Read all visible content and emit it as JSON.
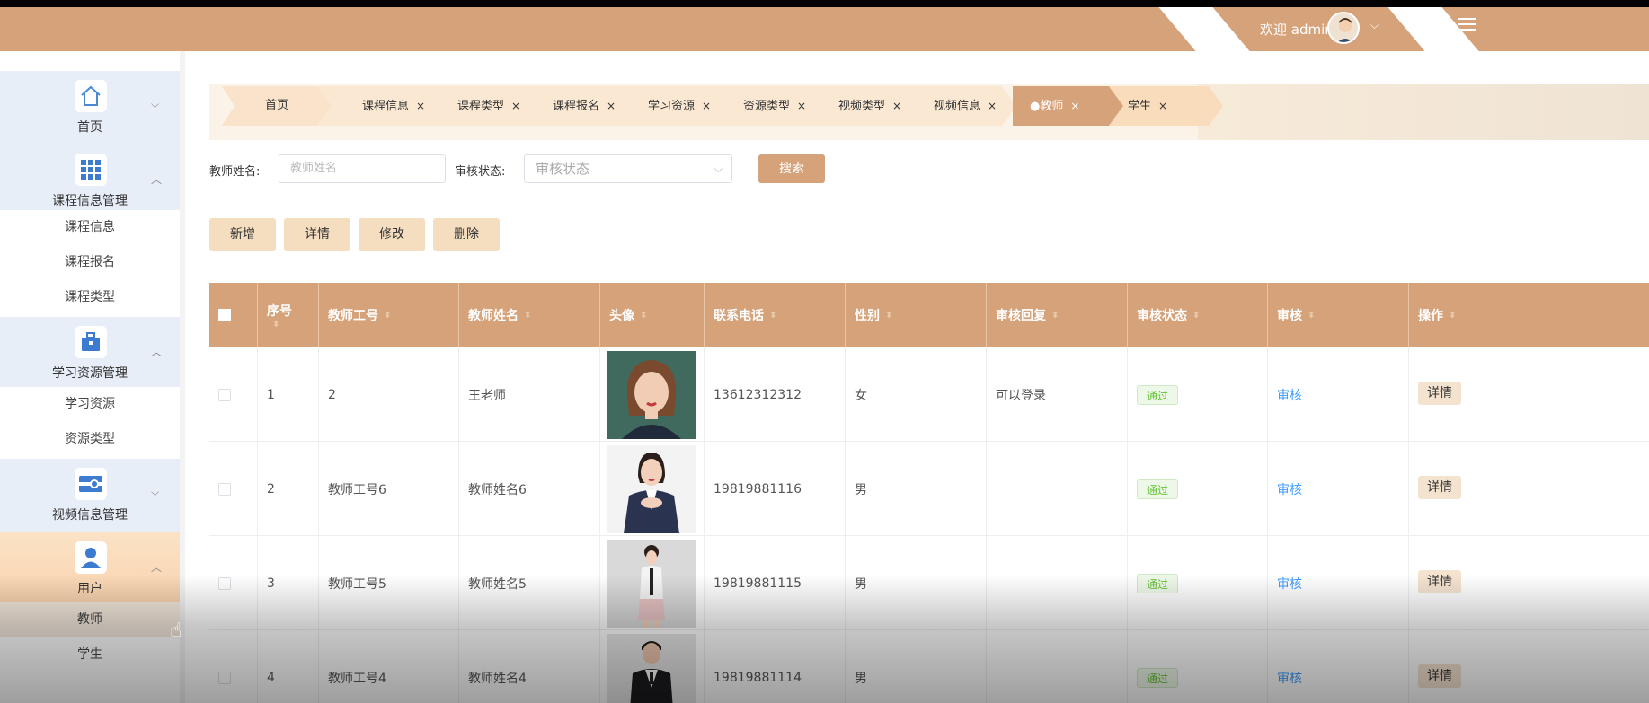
{
  "header": {
    "welcome_text": "欢迎 admin",
    "chevron_icon": "chevron-down-icon",
    "menu_icon": "menu-toggle-icon"
  },
  "sidebar": {
    "groups": [
      {
        "label": "首页",
        "icon": "home-icon",
        "expanded": false,
        "sub": []
      },
      {
        "label": "课程信息管理",
        "icon": "grid-icon",
        "expanded": true,
        "sub": [
          "课程信息",
          "课程报名",
          "课程类型"
        ]
      },
      {
        "label": "学习资源管理",
        "icon": "briefcase-icon",
        "expanded": true,
        "sub": [
          "学习资源",
          "资源类型"
        ]
      },
      {
        "label": "视频信息管理",
        "icon": "video-icon",
        "expanded": false,
        "sub": []
      },
      {
        "label": "用户",
        "icon": "user-icon",
        "expanded": true,
        "sub": [
          "教师",
          "学生"
        ]
      }
    ],
    "active_sub": "教师"
  },
  "tabs": [
    {
      "label": "首页",
      "closable": false
    },
    {
      "label": "课程信息",
      "closable": true
    },
    {
      "label": "课程类型",
      "closable": true
    },
    {
      "label": "课程报名",
      "closable": true
    },
    {
      "label": "学习资源",
      "closable": true
    },
    {
      "label": "资源类型",
      "closable": true
    },
    {
      "label": "视频类型",
      "closable": true
    },
    {
      "label": "视频信息",
      "closable": true
    },
    {
      "label": "●教师",
      "closable": true,
      "active": true
    },
    {
      "label": "学生",
      "closable": true
    }
  ],
  "tab_close_symbol": "×",
  "search": {
    "name_label": "教师姓名:",
    "name_placeholder": "教师姓名",
    "status_label": "审核状态:",
    "status_placeholder": "审核状态",
    "search_button": "搜索"
  },
  "actions": {
    "add": "新增",
    "detail": "详情",
    "edit": "修改",
    "delete": "删除"
  },
  "table": {
    "columns": [
      "序号",
      "教师工号",
      "教师姓名",
      "头像",
      "联系电话",
      "性别",
      "审核回复",
      "审核状态",
      "审核",
      "操作"
    ],
    "rows": [
      {
        "index": "1",
        "teacher_no": "2",
        "name": "王老师",
        "phone": "13612312312",
        "gender": "女",
        "reply": "可以登录",
        "status": "通过",
        "review": "审核",
        "op": "详情"
      },
      {
        "index": "2",
        "teacher_no": "教师工号6",
        "name": "教师姓名6",
        "phone": "19819881116",
        "gender": "男",
        "reply": "",
        "status": "通过",
        "review": "审核",
        "op": "详情"
      },
      {
        "index": "3",
        "teacher_no": "教师工号5",
        "name": "教师姓名5",
        "phone": "19819881115",
        "gender": "男",
        "reply": "",
        "status": "通过",
        "review": "审核",
        "op": "详情"
      },
      {
        "index": "4",
        "teacher_no": "教师工号4",
        "name": "教师姓名4",
        "phone": "19819881114",
        "gender": "男",
        "reply": "",
        "status": "通过",
        "review": "审核",
        "op": "详情"
      }
    ]
  },
  "colors": {
    "primary": "#d6a27a",
    "button_light": "#f5ddbf",
    "badge_green": "#67c23a",
    "link_blue": "#409eff"
  }
}
